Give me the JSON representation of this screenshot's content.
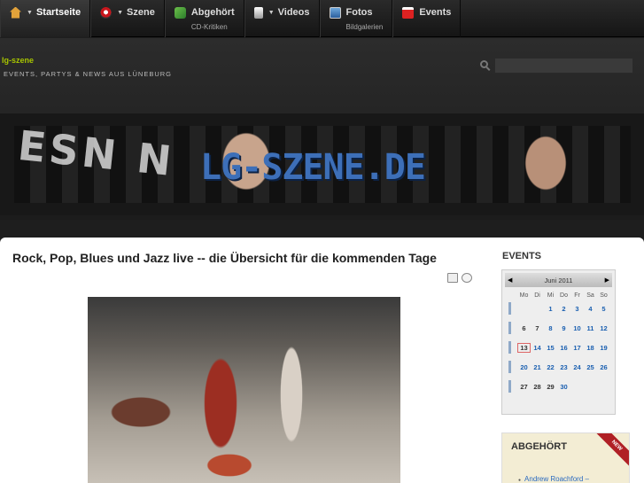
{
  "nav": {
    "items": [
      {
        "label": "Startseite",
        "sub": "",
        "icon": "home-icon",
        "caret": true
      },
      {
        "label": "Szene",
        "sub": "",
        "icon": "szene-icon",
        "caret": true
      },
      {
        "label": "Abgehört",
        "sub": "CD-Kritiken",
        "icon": "music-icon",
        "caret": false
      },
      {
        "label": "Videos",
        "sub": "",
        "icon": "video-icon",
        "caret": true
      },
      {
        "label": "Fotos",
        "sub": "Bildgalerien",
        "icon": "photos-icon",
        "caret": false
      },
      {
        "label": "Events",
        "sub": "",
        "icon": "events-icon",
        "caret": false
      }
    ]
  },
  "header": {
    "site_name": "lg-szene",
    "tagline": "EVENTS, PARTYS & NEWS AUS LÜNEBURG",
    "search_placeholder": "",
    "banner_logo": "LG-SZENE.DE",
    "banner_letters": "ESN N"
  },
  "article": {
    "title": "Rock, Pop, Blues und Jazz live -- die Übersicht für die kommenden Tage"
  },
  "sidebar": {
    "events_heading": "EVENTS",
    "calendar": {
      "month": "Juni 2011",
      "prev": "◀",
      "next": "▶",
      "weekdays": [
        "Mo",
        "Di",
        "Mi",
        "Do",
        "Fr",
        "Sa",
        "So"
      ],
      "weeks": [
        [
          "",
          "",
          "1",
          "2",
          "3",
          "4",
          "5"
        ],
        [
          "6",
          "7",
          "8",
          "9",
          "10",
          "11",
          "12"
        ],
        [
          "13",
          "14",
          "15",
          "16",
          "17",
          "18",
          "19"
        ],
        [
          "20",
          "21",
          "22",
          "23",
          "24",
          "25",
          "26"
        ],
        [
          "27",
          "28",
          "29",
          "30",
          "",
          "",
          ""
        ]
      ],
      "today": "13"
    },
    "abgehoert": {
      "title": "ABGEHÖRT",
      "ribbon": "NEW",
      "link": "Andrew Roachford –"
    }
  },
  "colors": {
    "accent_green": "#a7c400",
    "link_blue": "#1a5fb0",
    "ribbon_red": "#b02025"
  }
}
